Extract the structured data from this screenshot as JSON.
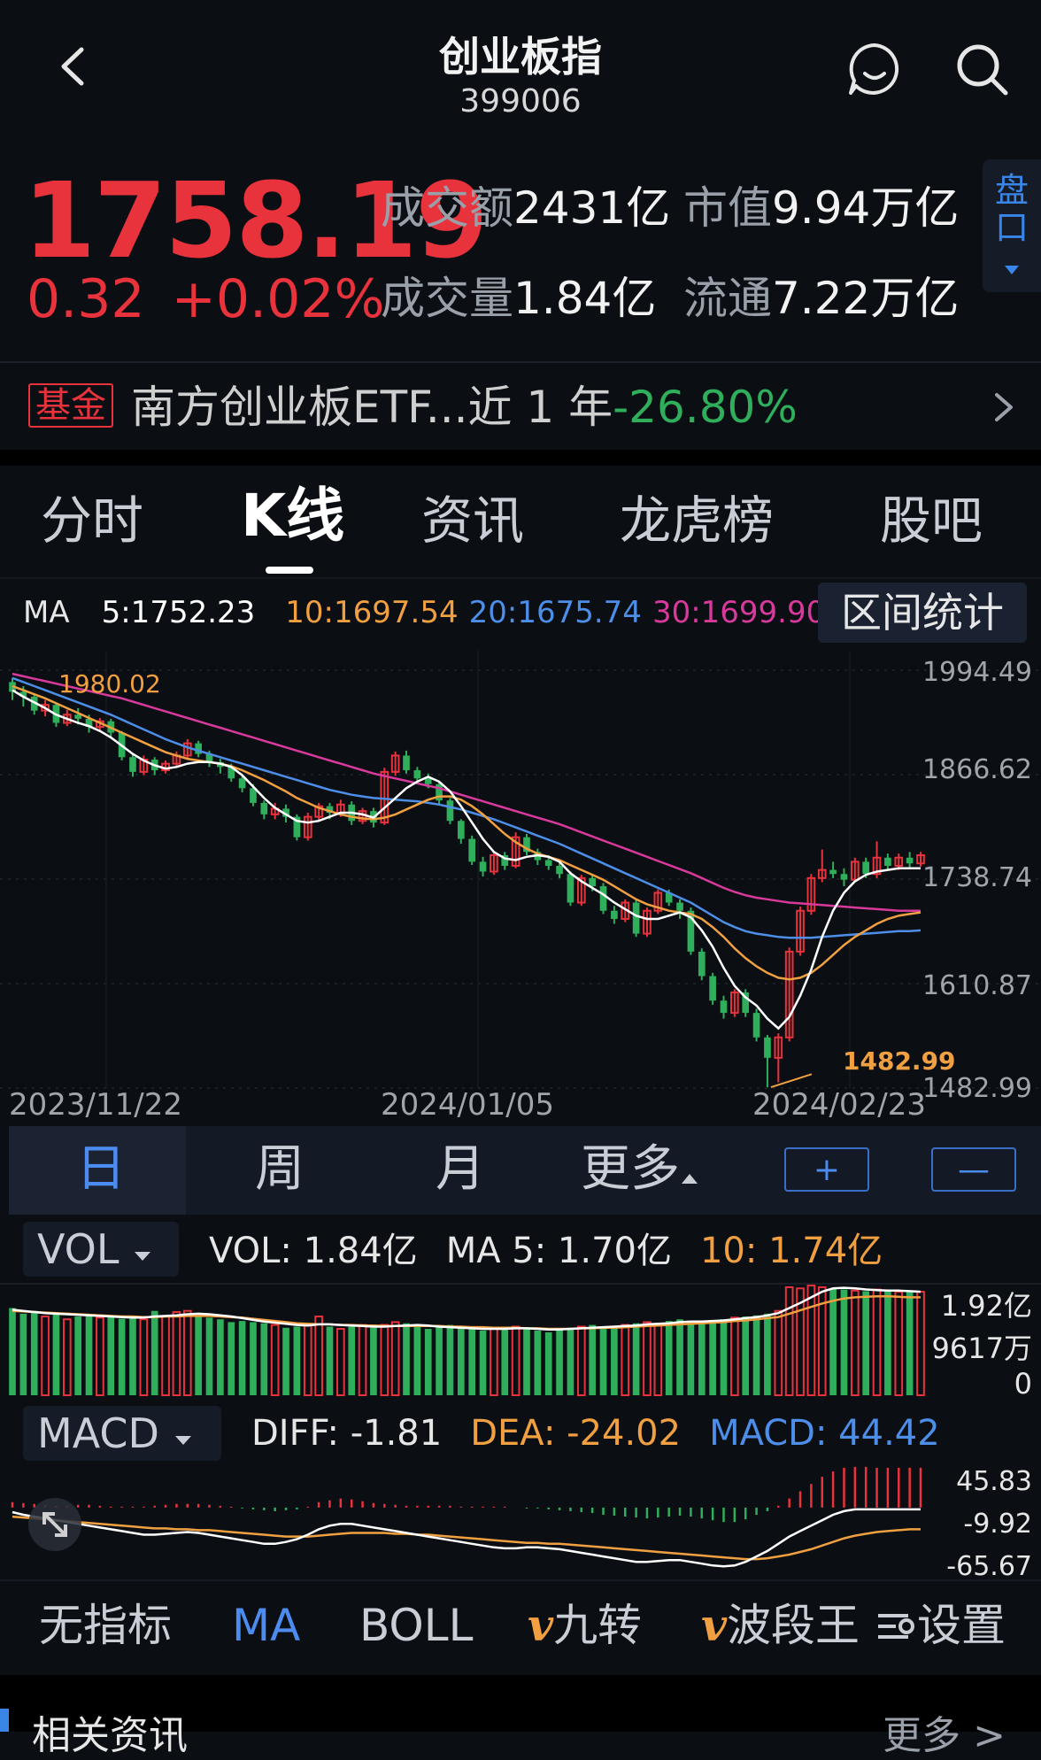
{
  "header": {
    "title": "创业板指",
    "code": "399006"
  },
  "quote": {
    "price": "1758.19",
    "change": "0.32",
    "change_pct": "+0.02%",
    "turnover_label": "成交额",
    "turnover": "2431亿",
    "mktcap_label": "市值",
    "mktcap": "9.94万亿",
    "volume_label": "成交量",
    "volume": "1.84亿",
    "float_label": "流通",
    "float": "7.22万亿",
    "pankou_label": "盘口",
    "up_color": "#e8323c",
    "down_color": "#2fae5b"
  },
  "fund": {
    "tag": "基金",
    "text": "南方创业板ETF...近 1 年",
    "pct": "-26.80%"
  },
  "tabs": [
    "分时",
    "K线",
    "资讯",
    "龙虎榜",
    "股吧"
  ],
  "ma_legend": {
    "label": "MA",
    "ma5": "5:1752.23",
    "ma10": "10:1697.54",
    "ma20": "20:1675.74",
    "ma30": "30:1699.90",
    "range_stats": "区间统计",
    "colors": {
      "ma5": "#ffffff",
      "ma10": "#f0a040",
      "ma20": "#4c8ee8",
      "ma30": "#d83a9c"
    }
  },
  "kline": {
    "y_ticks": [
      "1994.49",
      "1866.62",
      "1738.74",
      "1610.87",
      "1482.99"
    ],
    "x_ticks": [
      "2023/11/22",
      "2024/01/05",
      "2024/02/23"
    ],
    "high_marker": "1980.02",
    "low_marker": "1482.99"
  },
  "periods": {
    "day": "日",
    "week": "周",
    "month": "月",
    "more": "更多",
    "zoom_in": "+",
    "zoom_out": "—"
  },
  "vol": {
    "selector": "VOL",
    "vol": "VOL:  1.84亿",
    "ma5": "MA 5:  1.70亿",
    "ma10": "10:  1.74亿",
    "y_ticks": [
      "1.92亿",
      "9617万",
      "0"
    ]
  },
  "macd": {
    "selector": "MACD",
    "diff": "DIFF:  -1.81",
    "dea": "DEA:  -24.02",
    "macd": "MACD:  44.42",
    "y_ticks": [
      "45.83",
      "-9.92",
      "-65.67"
    ]
  },
  "indicators": [
    "无指标",
    "MA",
    "BOLL",
    "九转",
    "波段王",
    "设置"
  ],
  "footer": {
    "left": "相关资讯",
    "right": "更多 >"
  },
  "chart_data": {
    "type": "candlestick",
    "y_range": [
      1482.99,
      1994.49
    ],
    "dates": [
      "2023/11/22",
      "2024/01/05",
      "2024/02/23"
    ],
    "candles": [
      [
        1980,
        1968,
        1985,
        1958
      ],
      [
        1968,
        1962,
        1975,
        1950
      ],
      [
        1962,
        1945,
        1966,
        1940
      ],
      [
        1945,
        1952,
        1958,
        1938
      ],
      [
        1952,
        1930,
        1955,
        1925
      ],
      [
        1930,
        1940,
        1946,
        1926
      ],
      [
        1940,
        1935,
        1948,
        1928
      ],
      [
        1935,
        1925,
        1940,
        1918
      ],
      [
        1925,
        1932,
        1936,
        1920
      ],
      [
        1932,
        1918,
        1935,
        1912
      ],
      [
        1918,
        1888,
        1920,
        1884
      ],
      [
        1888,
        1870,
        1892,
        1864
      ],
      [
        1870,
        1885,
        1890,
        1866
      ],
      [
        1885,
        1872,
        1888,
        1866
      ],
      [
        1872,
        1880,
        1884,
        1868
      ],
      [
        1880,
        1890,
        1895,
        1875
      ],
      [
        1890,
        1905,
        1910,
        1885
      ],
      [
        1905,
        1892,
        1908,
        1888
      ],
      [
        1892,
        1882,
        1896,
        1876
      ],
      [
        1882,
        1876,
        1886,
        1868
      ],
      [
        1876,
        1862,
        1880,
        1858
      ],
      [
        1862,
        1850,
        1865,
        1845
      ],
      [
        1850,
        1832,
        1855,
        1828
      ],
      [
        1832,
        1818,
        1835,
        1812
      ],
      [
        1818,
        1825,
        1832,
        1812
      ],
      [
        1825,
        1815,
        1830,
        1808
      ],
      [
        1815,
        1790,
        1818,
        1786
      ],
      [
        1790,
        1815,
        1820,
        1786
      ],
      [
        1815,
        1828,
        1832,
        1810
      ],
      [
        1828,
        1820,
        1832,
        1812
      ],
      [
        1820,
        1830,
        1836,
        1815
      ],
      [
        1830,
        1810,
        1834,
        1805
      ],
      [
        1810,
        1822,
        1826,
        1806
      ],
      [
        1822,
        1808,
        1826,
        1802
      ],
      [
        1808,
        1870,
        1875,
        1805
      ],
      [
        1870,
        1890,
        1895,
        1865
      ],
      [
        1890,
        1872,
        1896,
        1868
      ],
      [
        1872,
        1862,
        1876,
        1856
      ],
      [
        1862,
        1855,
        1868,
        1850
      ],
      [
        1855,
        1835,
        1858,
        1830
      ],
      [
        1835,
        1810,
        1838,
        1806
      ],
      [
        1810,
        1788,
        1812,
        1782
      ],
      [
        1788,
        1760,
        1792,
        1756
      ],
      [
        1760,
        1748,
        1766,
        1742
      ],
      [
        1748,
        1768,
        1772,
        1744
      ],
      [
        1768,
        1755,
        1772,
        1750
      ],
      [
        1755,
        1790,
        1796,
        1752
      ],
      [
        1790,
        1772,
        1794,
        1768
      ],
      [
        1772,
        1762,
        1776,
        1756
      ],
      [
        1762,
        1755,
        1768,
        1750
      ],
      [
        1755,
        1745,
        1760,
        1740
      ],
      [
        1745,
        1710,
        1748,
        1706
      ],
      [
        1710,
        1740,
        1744,
        1706
      ],
      [
        1740,
        1730,
        1744,
        1724
      ],
      [
        1730,
        1700,
        1734,
        1696
      ],
      [
        1700,
        1690,
        1706,
        1684
      ],
      [
        1690,
        1710,
        1714,
        1686
      ],
      [
        1710,
        1672,
        1714,
        1668
      ],
      [
        1672,
        1700,
        1704,
        1668
      ],
      [
        1700,
        1722,
        1726,
        1696
      ],
      [
        1722,
        1710,
        1726,
        1706
      ],
      [
        1710,
        1700,
        1714,
        1690
      ],
      [
        1700,
        1650,
        1704,
        1646
      ],
      [
        1650,
        1620,
        1654,
        1615
      ],
      [
        1620,
        1590,
        1624,
        1585
      ],
      [
        1590,
        1575,
        1596,
        1568
      ],
      [
        1575,
        1600,
        1604,
        1570
      ],
      [
        1600,
        1575,
        1604,
        1570
      ],
      [
        1575,
        1545,
        1580,
        1540
      ],
      [
        1545,
        1520,
        1548,
        1484
      ],
      [
        1520,
        1545,
        1550,
        1490
      ],
      [
        1545,
        1650,
        1655,
        1540
      ],
      [
        1650,
        1700,
        1705,
        1645
      ],
      [
        1700,
        1740,
        1745,
        1695
      ],
      [
        1740,
        1750,
        1775,
        1735
      ],
      [
        1750,
        1745,
        1760,
        1740
      ],
      [
        1745,
        1738,
        1752,
        1730
      ],
      [
        1738,
        1760,
        1765,
        1735
      ],
      [
        1760,
        1745,
        1765,
        1740
      ],
      [
        1745,
        1765,
        1785,
        1740
      ],
      [
        1765,
        1755,
        1770,
        1750
      ],
      [
        1755,
        1765,
        1770,
        1750
      ],
      [
        1765,
        1758,
        1772,
        1752
      ],
      [
        1758,
        1768,
        1772,
        1754
      ]
    ],
    "ma5": [
      1970,
      1962,
      1955,
      1948,
      1940,
      1935,
      1930,
      1926,
      1920,
      1912,
      1902,
      1892,
      1884,
      1878,
      1874,
      1876,
      1880,
      1882,
      1882,
      1880,
      1876,
      1866,
      1852,
      1838,
      1826,
      1818,
      1810,
      1808,
      1810,
      1815,
      1820,
      1820,
      1818,
      1814,
      1826,
      1838,
      1850,
      1858,
      1864,
      1858,
      1846,
      1828,
      1808,
      1788,
      1772,
      1764,
      1762,
      1766,
      1768,
      1766,
      1760,
      1746,
      1736,
      1728,
      1720,
      1710,
      1702,
      1694,
      1690,
      1690,
      1694,
      1698,
      1692,
      1676,
      1656,
      1630,
      1608,
      1594,
      1584,
      1568,
      1556,
      1570,
      1596,
      1628,
      1668,
      1700,
      1722,
      1736,
      1744,
      1748,
      1750,
      1752,
      1752,
      1752
    ],
    "ma10": [
      1975,
      1970,
      1965,
      1960,
      1954,
      1948,
      1942,
      1936,
      1930,
      1924,
      1918,
      1912,
      1906,
      1900,
      1894,
      1890,
      1886,
      1884,
      1882,
      1880,
      1877,
      1872,
      1866,
      1860,
      1853,
      1846,
      1838,
      1832,
      1826,
      1822,
      1818,
      1815,
      1813,
      1812,
      1814,
      1818,
      1824,
      1830,
      1836,
      1840,
      1840,
      1836,
      1828,
      1818,
      1806,
      1794,
      1784,
      1776,
      1770,
      1766,
      1762,
      1756,
      1750,
      1744,
      1738,
      1730,
      1722,
      1714,
      1708,
      1704,
      1700,
      1698,
      1696,
      1690,
      1680,
      1668,
      1654,
      1642,
      1632,
      1624,
      1618,
      1616,
      1618,
      1624,
      1634,
      1646,
      1658,
      1668,
      1676,
      1684,
      1690,
      1694,
      1696,
      1698
    ],
    "ma20": [
      1985,
      1980,
      1975,
      1970,
      1965,
      1960,
      1955,
      1950,
      1945,
      1940,
      1934,
      1928,
      1922,
      1916,
      1910,
      1905,
      1900,
      1896,
      1892,
      1888,
      1884,
      1880,
      1876,
      1872,
      1868,
      1864,
      1860,
      1856,
      1852,
      1848,
      1845,
      1842,
      1840,
      1838,
      1837,
      1836,
      1835,
      1834,
      1832,
      1830,
      1827,
      1824,
      1820,
      1816,
      1812,
      1807,
      1802,
      1797,
      1792,
      1787,
      1782,
      1776,
      1770,
      1764,
      1758,
      1752,
      1746,
      1740,
      1734,
      1728,
      1722,
      1716,
      1710,
      1702,
      1694,
      1686,
      1680,
      1675,
      1672,
      1670,
      1668,
      1667,
      1667,
      1667,
      1668,
      1669,
      1670,
      1671,
      1672,
      1673,
      1674,
      1675,
      1675,
      1676
    ],
    "ma30": [
      1990,
      1987,
      1984,
      1981,
      1978,
      1975,
      1972,
      1969,
      1966,
      1963,
      1960,
      1956,
      1952,
      1948,
      1944,
      1940,
      1936,
      1932,
      1928,
      1924,
      1920,
      1916,
      1912,
      1908,
      1904,
      1900,
      1896,
      1892,
      1888,
      1884,
      1880,
      1876,
      1872,
      1868,
      1865,
      1862,
      1859,
      1856,
      1853,
      1850,
      1846,
      1842,
      1838,
      1834,
      1830,
      1826,
      1822,
      1818,
      1814,
      1810,
      1806,
      1801,
      1796,
      1791,
      1786,
      1781,
      1776,
      1771,
      1766,
      1761,
      1756,
      1751,
      1746,
      1740,
      1734,
      1728,
      1723,
      1719,
      1716,
      1714,
      1712,
      1710,
      1709,
      1708,
      1707,
      1706,
      1705,
      1704,
      1703,
      1702,
      1701,
      1700,
      1700,
      1700
    ],
    "volume_max": 1.92,
    "volume": [
      1.55,
      1.45,
      1.5,
      1.4,
      1.45,
      1.35,
      1.4,
      1.42,
      1.38,
      1.4,
      1.36,
      1.38,
      1.35,
      1.5,
      1.4,
      1.48,
      1.5,
      1.42,
      1.38,
      1.35,
      1.3,
      1.32,
      1.3,
      1.28,
      1.25,
      1.2,
      1.22,
      1.25,
      1.4,
      1.22,
      1.18,
      1.22,
      1.25,
      1.2,
      1.25,
      1.3,
      1.28,
      1.22,
      1.18,
      1.22,
      1.25,
      1.2,
      1.18,
      1.15,
      1.2,
      1.18,
      1.22,
      1.2,
      1.15,
      1.12,
      1.18,
      1.2,
      1.22,
      1.25,
      1.2,
      1.22,
      1.25,
      1.28,
      1.3,
      1.25,
      1.32,
      1.35,
      1.3,
      1.28,
      1.32,
      1.35,
      1.38,
      1.4,
      1.42,
      1.45,
      1.5,
      1.92,
      1.9,
      1.95,
      1.92,
      1.9,
      1.88,
      1.86,
      1.85,
      1.88,
      1.86,
      1.84,
      1.84,
      1.84
    ],
    "vol_ma5": [
      1.52,
      1.5,
      1.48,
      1.46,
      1.45,
      1.44,
      1.43,
      1.42,
      1.41,
      1.4,
      1.39,
      1.38,
      1.38,
      1.4,
      1.41,
      1.42,
      1.44,
      1.45,
      1.44,
      1.42,
      1.4,
      1.37,
      1.34,
      1.31,
      1.29,
      1.27,
      1.25,
      1.24,
      1.26,
      1.26,
      1.25,
      1.24,
      1.23,
      1.22,
      1.22,
      1.23,
      1.24,
      1.25,
      1.24,
      1.22,
      1.21,
      1.2,
      1.19,
      1.18,
      1.18,
      1.18,
      1.19,
      1.19,
      1.18,
      1.17,
      1.17,
      1.18,
      1.19,
      1.2,
      1.21,
      1.22,
      1.23,
      1.24,
      1.26,
      1.27,
      1.28,
      1.3,
      1.31,
      1.31,
      1.32,
      1.33,
      1.35,
      1.37,
      1.39,
      1.42,
      1.46,
      1.55,
      1.64,
      1.74,
      1.84,
      1.9,
      1.91,
      1.9,
      1.88,
      1.87,
      1.86,
      1.86,
      1.85,
      1.84
    ],
    "vol_ma10": [
      1.5,
      1.49,
      1.48,
      1.47,
      1.46,
      1.45,
      1.44,
      1.43,
      1.42,
      1.41,
      1.4,
      1.4,
      1.39,
      1.39,
      1.4,
      1.4,
      1.41,
      1.41,
      1.41,
      1.4,
      1.39,
      1.38,
      1.36,
      1.34,
      1.32,
      1.3,
      1.28,
      1.27,
      1.26,
      1.26,
      1.25,
      1.25,
      1.24,
      1.24,
      1.23,
      1.23,
      1.23,
      1.23,
      1.23,
      1.23,
      1.22,
      1.22,
      1.21,
      1.21,
      1.2,
      1.2,
      1.2,
      1.19,
      1.19,
      1.18,
      1.18,
      1.18,
      1.19,
      1.19,
      1.2,
      1.2,
      1.21,
      1.22,
      1.23,
      1.24,
      1.25,
      1.26,
      1.27,
      1.28,
      1.29,
      1.3,
      1.32,
      1.33,
      1.35,
      1.37,
      1.39,
      1.45,
      1.51,
      1.57,
      1.63,
      1.68,
      1.72,
      1.74,
      1.75,
      1.76,
      1.76,
      1.75,
      1.74,
      1.74
    ],
    "macd_range": [
      -65.67,
      45.83
    ],
    "diff": [
      -5,
      -8,
      -10,
      -12,
      -14,
      -16,
      -18,
      -20,
      -22,
      -24,
      -26,
      -28,
      -30,
      -30,
      -29,
      -28,
      -27,
      -28,
      -30,
      -32,
      -34,
      -36,
      -38,
      -40,
      -40,
      -38,
      -35,
      -30,
      -24,
      -20,
      -18,
      -18,
      -20,
      -22,
      -24,
      -26,
      -28,
      -30,
      -32,
      -34,
      -36,
      -38,
      -40,
      -42,
      -44,
      -45,
      -45,
      -44,
      -44,
      -45,
      -46,
      -48,
      -50,
      -52,
      -54,
      -56,
      -58,
      -60,
      -60,
      -59,
      -58,
      -58,
      -60,
      -62,
      -64,
      -65,
      -64,
      -60,
      -54,
      -48,
      -40,
      -32,
      -26,
      -20,
      -14,
      -8,
      -4,
      -2,
      -2,
      -2,
      -2,
      -2,
      -2,
      -2
    ],
    "dea": [
      -10,
      -11,
      -12,
      -13,
      -14,
      -15,
      -16,
      -17,
      -18,
      -19,
      -20,
      -21,
      -22,
      -23,
      -23,
      -24,
      -24,
      -25,
      -25,
      -26,
      -27,
      -28,
      -29,
      -30,
      -31,
      -32,
      -32,
      -32,
      -31,
      -30,
      -29,
      -28,
      -28,
      -28,
      -28,
      -29,
      -29,
      -30,
      -30,
      -31,
      -32,
      -33,
      -34,
      -35,
      -36,
      -37,
      -38,
      -39,
      -39,
      -40,
      -40,
      -41,
      -42,
      -43,
      -44,
      -45,
      -46,
      -47,
      -48,
      -49,
      -50,
      -51,
      -52,
      -53,
      -54,
      -55,
      -56,
      -57,
      -57,
      -56,
      -54,
      -52,
      -49,
      -46,
      -42,
      -38,
      -34,
      -31,
      -29,
      -27,
      -26,
      -25,
      -24,
      -24
    ],
    "macd_hist": [
      6,
      5,
      4,
      3,
      2,
      2,
      3,
      3,
      2,
      1,
      1,
      1,
      1,
      2,
      3,
      4,
      4,
      4,
      3,
      2,
      1,
      -1,
      -2,
      -3,
      -4,
      -3,
      -2,
      1,
      6,
      8,
      10,
      9,
      7,
      5,
      4,
      3,
      2,
      2,
      2,
      2,
      2,
      1,
      1,
      1,
      1,
      1,
      0,
      -1,
      -1,
      -2,
      -3,
      -4,
      -5,
      -6,
      -8,
      -9,
      -10,
      -11,
      -12,
      -11,
      -10,
      -9,
      -10,
      -12,
      -14,
      -16,
      -16,
      -13,
      -8,
      -4,
      2,
      10,
      18,
      26,
      34,
      40,
      44,
      45,
      45,
      44,
      44,
      44,
      44,
      44
    ]
  }
}
